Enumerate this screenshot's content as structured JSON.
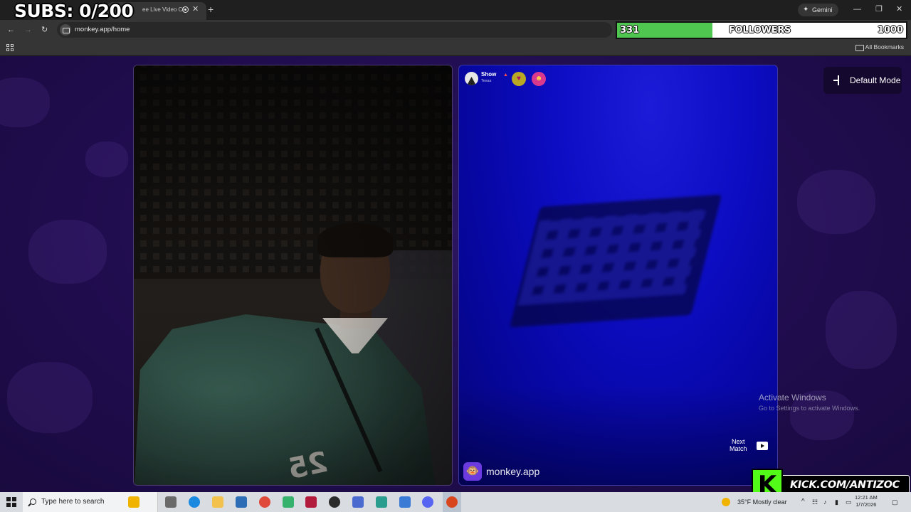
{
  "overlay": {
    "subs_label": "SUBS: 0/200",
    "followers": {
      "count": "331",
      "label": "FOLLOWERS",
      "goal": "1000",
      "progress_fraction": 0.331,
      "fill_color": "#4fc64f"
    },
    "kick": {
      "logo_letter": "K",
      "url": "KICK.COM/ANTIZOC",
      "color": "#53fc18"
    }
  },
  "browser": {
    "tab_title": "ee Live Video Cl",
    "gemini_label": "Gemini",
    "address": "monkey.app/home",
    "bookmarks_all": "All Bookmarks"
  },
  "page": {
    "mode_button": "Default Mode",
    "partner": {
      "name": "Show",
      "location": "Texas"
    },
    "next_match_label": "Next\nMatch",
    "brand_name": "monkey.app",
    "brand_emoji": "🐵",
    "jersey_number": "25",
    "watermark_title": "Activate Windows",
    "watermark_sub": "Go to Settings to activate Windows."
  },
  "taskbar": {
    "search_placeholder": "Type here to search",
    "weather": "35°F  Mostly clear",
    "time": "12:21 AM",
    "date": "1/7/2026"
  },
  "colors": {
    "page_bg": "#1f0c4d",
    "accent_purple": "#6b3be0",
    "kick_green": "#53fc18"
  }
}
